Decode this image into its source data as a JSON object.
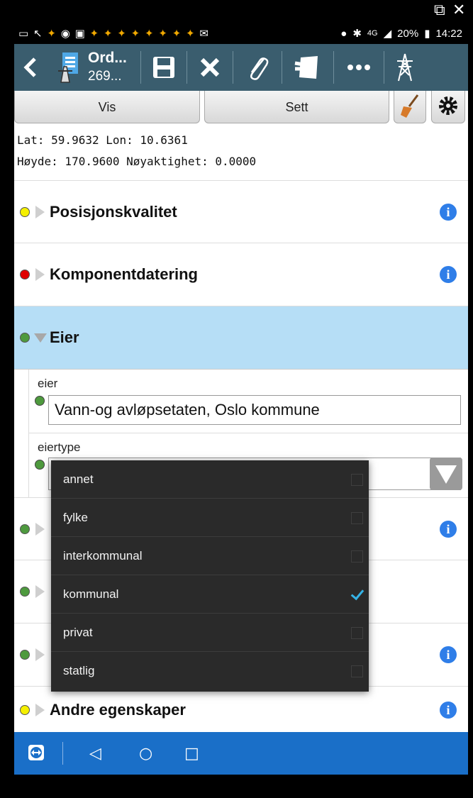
{
  "window": {
    "popout_icon": "popout-icon",
    "close_icon": "close-icon"
  },
  "status_bar": {
    "left_icons": [
      "screen-icon",
      "missed-call-icon",
      "star-icon",
      "eye-icon",
      "app-icon",
      "star-icon",
      "star-icon",
      "star-icon",
      "star-icon",
      "star-icon",
      "star-icon",
      "star-icon",
      "star-icon",
      "mail-icon"
    ],
    "battery": "20%",
    "time": "14:22",
    "network": "4G"
  },
  "toolbar": {
    "title": "Ord...",
    "subtitle": "269...",
    "back_icon": "back-icon",
    "save_icon": "save-icon",
    "cancel_icon": "cancel-icon",
    "attach_icon": "paperclip-icon",
    "notes_icon": "notes-icon",
    "more_icon": "more-icon",
    "mast_icon": "pylon-icon"
  },
  "buttons": {
    "vis": "Vis",
    "sett": "Sett"
  },
  "coords": {
    "line1": "Lat: 59.9632 Lon: 10.6361",
    "line2": "Høyde: 170.9600 Nøyaktighet: 0.0000"
  },
  "sections": {
    "posisjon": {
      "title": "Posisjonskvalitet",
      "dot_color": "#f5f000"
    },
    "komponent": {
      "title": "Komponentdatering",
      "dot_color": "#e00000"
    },
    "eier": {
      "title": "Eier",
      "dot_color": "#4e9a3e",
      "highlight": "#b6def6"
    },
    "andre": {
      "title": "Andre egenskaper",
      "dot_color": "#f5f000"
    }
  },
  "fields": {
    "eier": {
      "label": "eier",
      "value": "Vann-og avløpsetaten, Oslo kommune"
    },
    "eiertype": {
      "label": "eiertype"
    }
  },
  "dropdown": {
    "options": [
      {
        "label": "annet",
        "checked": false
      },
      {
        "label": "fylke",
        "checked": false
      },
      {
        "label": "interkommunal",
        "checked": false
      },
      {
        "label": "kommunal",
        "checked": true
      },
      {
        "label": "privat",
        "checked": false
      },
      {
        "label": "statlig",
        "checked": false
      }
    ]
  },
  "colors": {
    "toolbar": "#3a5d6e",
    "nav": "#1a6fc8",
    "info": "#2f7ee8",
    "accent_check": "#35b3e6"
  }
}
